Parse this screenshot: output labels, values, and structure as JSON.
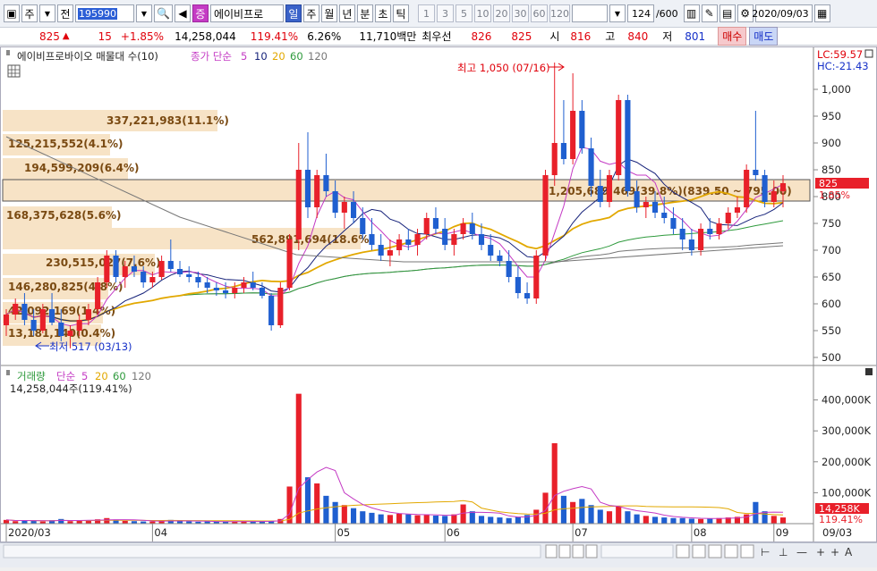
{
  "toolbar": {
    "market": "주",
    "prev": "전",
    "code": "195990",
    "stock_name": "에이비프로",
    "name_badge": "증",
    "periods": [
      "일",
      "주",
      "월",
      "년",
      "분",
      "초",
      "틱"
    ],
    "active_period": "일",
    "intervals": [
      "1",
      "3",
      "5",
      "10",
      "20",
      "30",
      "60",
      "120"
    ],
    "count": "124",
    "count_total": "/600",
    "date": "2020/09/03"
  },
  "quote": {
    "price": "825",
    "arrow": "▲",
    "change": "15",
    "change_pct": "+1.85%",
    "volume": "14,258,044",
    "volume_pct": "119.41%",
    "turnover_pct": "6.26%",
    "amount": "11,710백만",
    "best_label": "최우선",
    "best_ask": "826",
    "best_bid": "825",
    "open_label": "시",
    "open": "816",
    "high_label": "고",
    "high": "840",
    "low_label": "저",
    "low": "801",
    "buy_label": "매수",
    "sell_label": "매도"
  },
  "price_panel": {
    "legend_title": "에이비프로바이오 매물대 수(10)",
    "ma_label": "종가 단순",
    "ma_periods": [
      "5",
      "10",
      "20",
      "60",
      "120"
    ],
    "lc": "LC:59.57",
    "hc": "HC:-21.43",
    "current_price": "825",
    "current_pct": "1.85%",
    "high_note": "최고 1,050 (07/16)",
    "low_note": "최저 517 (03/13)",
    "y_ticks": [
      "1,000",
      "950",
      "900",
      "850",
      "800",
      "750",
      "700",
      "650",
      "600",
      "550",
      "500"
    ],
    "volume_profile": [
      "337,221,983(11.1%)",
      "125,215,552(4.1%)",
      "194,599,209(6.4%)",
      "1,205,689,469(39.8%)(839.50 ~ 795.00)",
      "168,375,628(5.6%)",
      "562,891,694(18.6%)",
      "230,515,027(7.6%)",
      "146,280,825(4.8%)",
      "42,092,169(1.4%)",
      "13,181,140(0.4%)"
    ]
  },
  "volume_panel": {
    "legend_title": "거래량",
    "ma_label": "단순",
    "ma_periods": [
      "5",
      "20",
      "60",
      "120"
    ],
    "current": "14,258,044주(119.41%)",
    "y_ticks": [
      "400,000K",
      "300,000K",
      "200,000K",
      "100,000K"
    ],
    "current_badge": "14,258K",
    "current_badge_pct": "119.41%"
  },
  "x_axis": [
    "2020/03",
    "04",
    "05",
    "06",
    "07",
    "08",
    "09"
  ],
  "x_axis_right": "09/03",
  "colors": {
    "up": "#e8202a",
    "down": "#1f5fd0",
    "ma5": "#c43bc4",
    "ma10": "#16227a",
    "ma20": "#e2a800",
    "ma60": "#2e9a3c",
    "ma120": "#777777",
    "profile": "#f7e3c6"
  },
  "candles": [
    [
      560,
      590,
      540,
      580
    ],
    [
      580,
      610,
      570,
      600
    ],
    [
      600,
      620,
      560,
      570
    ],
    [
      570,
      590,
      540,
      550
    ],
    [
      550,
      600,
      545,
      590
    ],
    [
      590,
      620,
      560,
      565
    ],
    [
      565,
      590,
      530,
      540
    ],
    [
      540,
      560,
      517,
      550
    ],
    [
      550,
      580,
      540,
      570
    ],
    [
      570,
      600,
      560,
      590
    ],
    [
      590,
      650,
      580,
      640
    ],
    [
      640,
      700,
      630,
      690
    ],
    [
      690,
      700,
      640,
      650
    ],
    [
      650,
      680,
      630,
      670
    ],
    [
      670,
      690,
      650,
      660
    ],
    [
      660,
      670,
      630,
      640
    ],
    [
      640,
      660,
      630,
      650
    ],
    [
      650,
      690,
      645,
      680
    ],
    [
      680,
      720,
      660,
      665
    ],
    [
      665,
      680,
      650,
      655
    ],
    [
      655,
      670,
      640,
      650
    ],
    [
      650,
      660,
      630,
      640
    ],
    [
      640,
      650,
      620,
      630
    ],
    [
      630,
      640,
      615,
      625
    ],
    [
      625,
      640,
      610,
      620
    ],
    [
      620,
      640,
      610,
      630
    ],
    [
      630,
      650,
      620,
      640
    ],
    [
      640,
      660,
      625,
      630
    ],
    [
      630,
      640,
      610,
      615
    ],
    [
      615,
      620,
      550,
      560
    ],
    [
      560,
      640,
      555,
      630
    ],
    [
      630,
      730,
      625,
      720
    ],
    [
      720,
      900,
      700,
      850
    ],
    [
      850,
      920,
      760,
      780
    ],
    [
      780,
      850,
      760,
      840
    ],
    [
      840,
      880,
      800,
      810
    ],
    [
      810,
      830,
      760,
      770
    ],
    [
      770,
      800,
      740,
      790
    ],
    [
      790,
      810,
      750,
      760
    ],
    [
      760,
      780,
      720,
      730
    ],
    [
      730,
      760,
      700,
      710
    ],
    [
      710,
      730,
      680,
      690
    ],
    [
      690,
      720,
      670,
      700
    ],
    [
      700,
      730,
      690,
      720
    ],
    [
      720,
      740,
      700,
      710
    ],
    [
      710,
      740,
      690,
      730
    ],
    [
      730,
      770,
      720,
      760
    ],
    [
      760,
      780,
      730,
      740
    ],
    [
      740,
      760,
      700,
      710
    ],
    [
      710,
      740,
      690,
      730
    ],
    [
      730,
      760,
      720,
      750
    ],
    [
      750,
      770,
      720,
      730
    ],
    [
      730,
      750,
      700,
      710
    ],
    [
      710,
      730,
      680,
      690
    ],
    [
      690,
      700,
      670,
      680
    ],
    [
      680,
      700,
      640,
      650
    ],
    [
      650,
      670,
      610,
      620
    ],
    [
      620,
      640,
      600,
      610
    ],
    [
      610,
      700,
      600,
      690
    ],
    [
      690,
      850,
      680,
      840
    ],
    [
      840,
      1050,
      820,
      900
    ],
    [
      900,
      980,
      860,
      870
    ],
    [
      870,
      1030,
      860,
      960
    ],
    [
      960,
      980,
      880,
      890
    ],
    [
      890,
      910,
      800,
      820
    ],
    [
      820,
      850,
      780,
      790
    ],
    [
      790,
      850,
      780,
      840
    ],
    [
      840,
      990,
      830,
      980
    ],
    [
      980,
      990,
      800,
      810
    ],
    [
      810,
      830,
      770,
      780
    ],
    [
      780,
      800,
      760,
      790
    ],
    [
      790,
      810,
      760,
      770
    ],
    [
      770,
      800,
      750,
      760
    ],
    [
      760,
      780,
      730,
      740
    ],
    [
      740,
      760,
      700,
      720
    ],
    [
      720,
      740,
      690,
      700
    ],
    [
      700,
      750,
      690,
      740
    ],
    [
      740,
      760,
      720,
      730
    ],
    [
      730,
      760,
      720,
      750
    ],
    [
      750,
      780,
      740,
      770
    ],
    [
      770,
      800,
      760,
      780
    ],
    [
      780,
      860,
      770,
      850
    ],
    [
      850,
      960,
      830,
      840
    ],
    [
      840,
      850,
      780,
      790
    ],
    [
      790,
      830,
      780,
      810
    ],
    [
      810,
      840,
      780,
      825
    ]
  ],
  "volumes": [
    12,
    8,
    10,
    9,
    7,
    11,
    15,
    8,
    9,
    10,
    14,
    18,
    12,
    9,
    8,
    7,
    7,
    9,
    12,
    8,
    7,
    6,
    7,
    6,
    6,
    7,
    8,
    7,
    6,
    9,
    15,
    120,
    420,
    150,
    130,
    90,
    70,
    60,
    50,
    40,
    35,
    30,
    28,
    32,
    30,
    27,
    28,
    26,
    25,
    30,
    62,
    40,
    25,
    22,
    20,
    18,
    22,
    28,
    45,
    100,
    260,
    90,
    70,
    80,
    60,
    45,
    40,
    55,
    40,
    30,
    25,
    22,
    20,
    18,
    18,
    16,
    15,
    17,
    18,
    20,
    22,
    30,
    70,
    40,
    25,
    20
  ]
}
